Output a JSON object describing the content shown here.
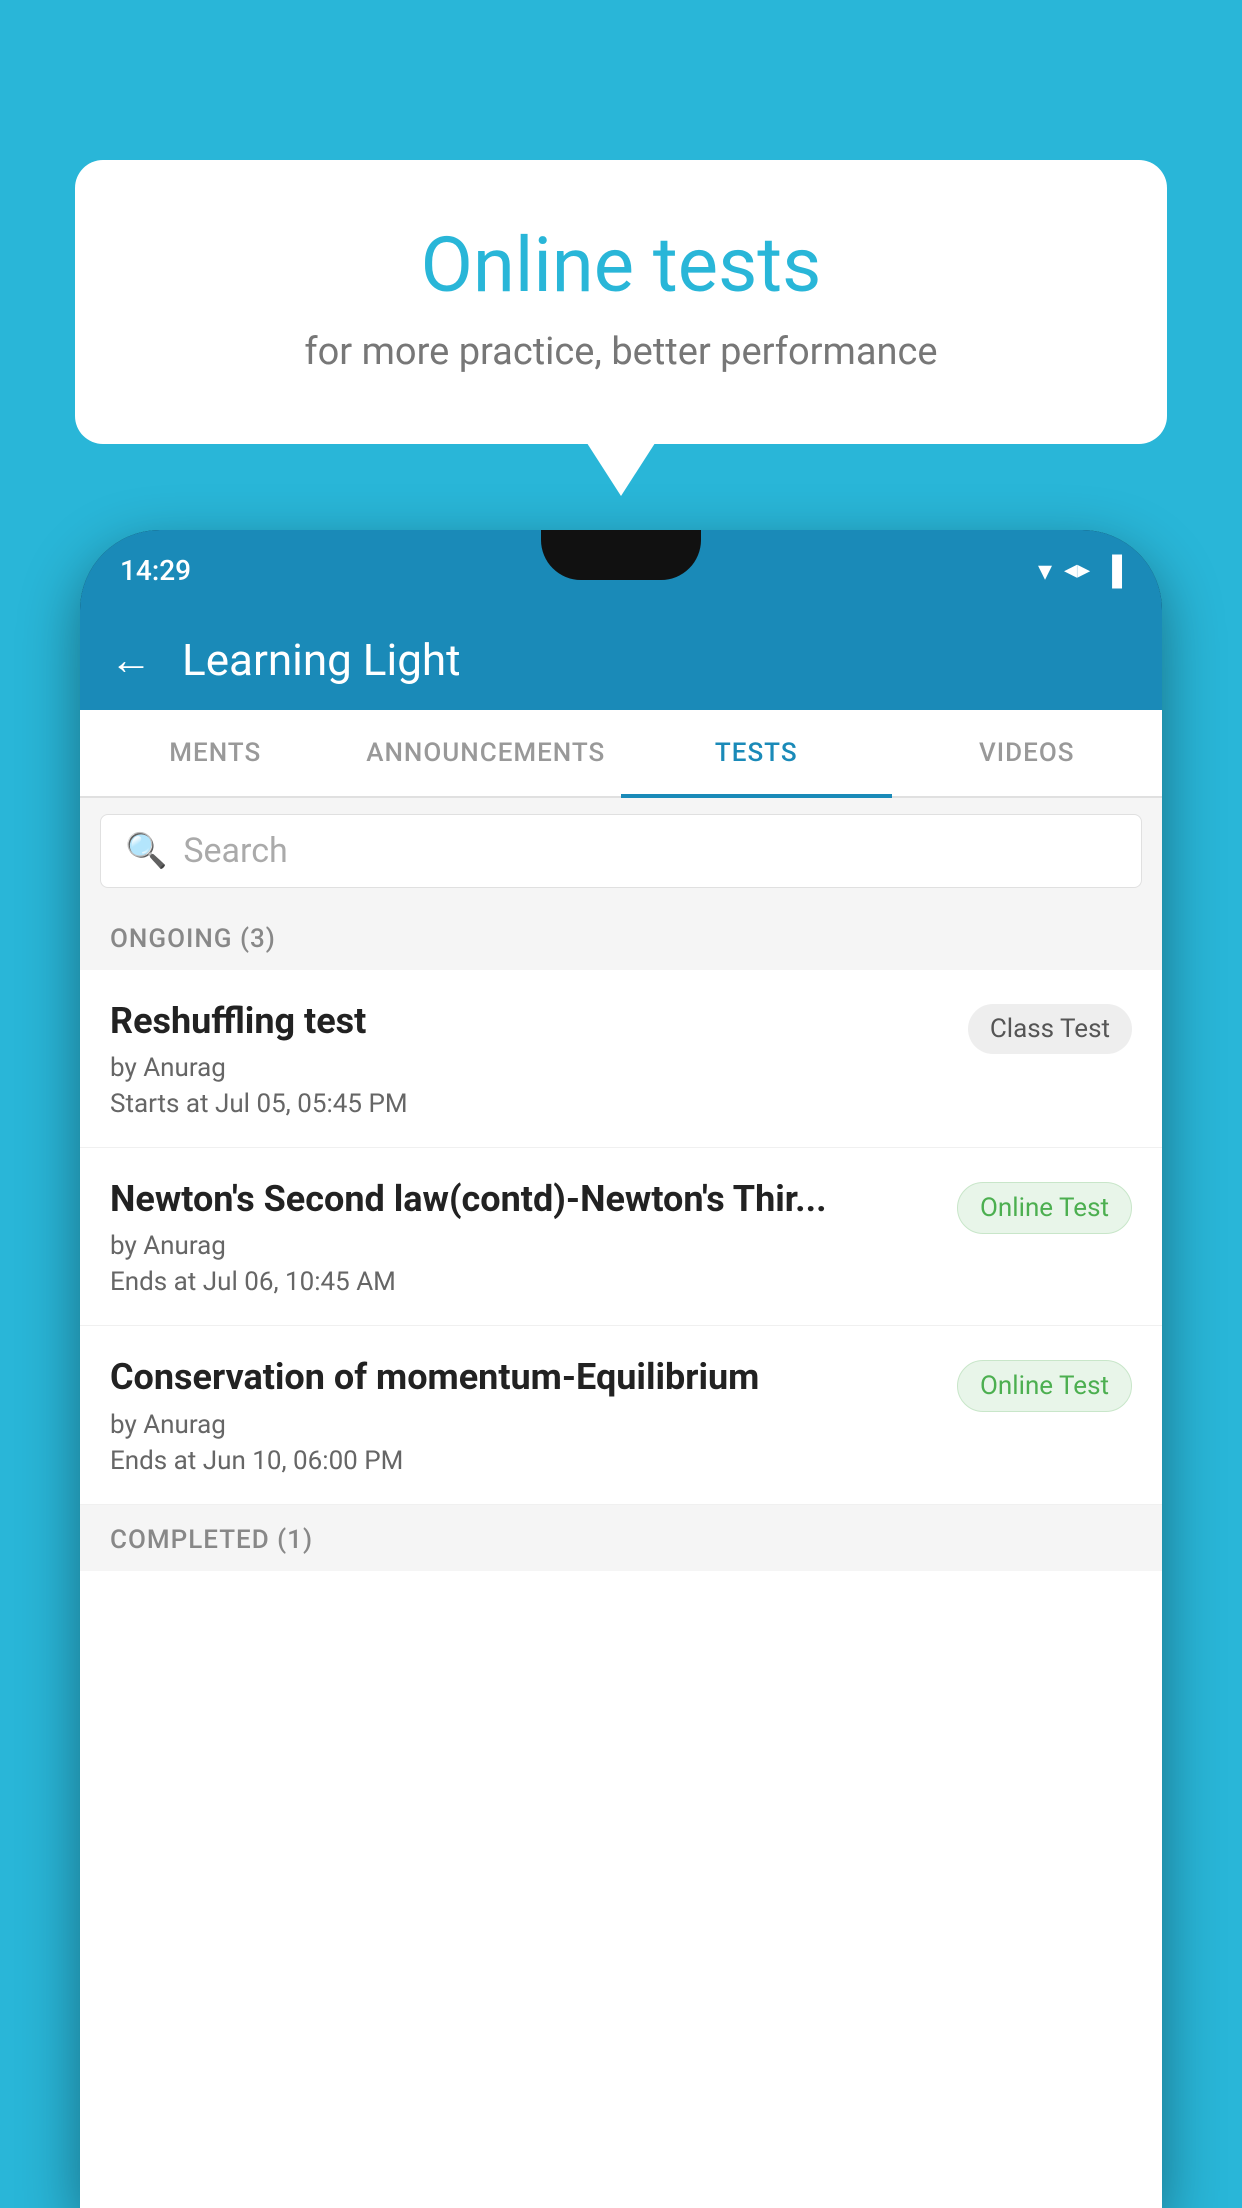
{
  "background": {
    "color": "#29b6d8"
  },
  "speech_bubble": {
    "title": "Online tests",
    "subtitle": "for more practice, better performance"
  },
  "phone": {
    "status_bar": {
      "time": "14:29",
      "wifi_icon": "▼",
      "signal_icon": "▲",
      "battery_icon": "▐"
    },
    "header": {
      "back_label": "←",
      "title": "Learning Light"
    },
    "tabs": [
      {
        "label": "MENTS",
        "active": false
      },
      {
        "label": "ANNOUNCEMENTS",
        "active": false
      },
      {
        "label": "TESTS",
        "active": true
      },
      {
        "label": "VIDEOS",
        "active": false
      }
    ],
    "search": {
      "placeholder": "Search"
    },
    "ongoing_section": {
      "title": "ONGOING (3)"
    },
    "tests": [
      {
        "name": "Reshuffling test",
        "author": "by Anurag",
        "date": "Starts at  Jul 05, 05:45 PM",
        "badge": "Class Test",
        "badge_type": "class"
      },
      {
        "name": "Newton's Second law(contd)-Newton's Thir...",
        "author": "by Anurag",
        "date": "Ends at  Jul 06, 10:45 AM",
        "badge": "Online Test",
        "badge_type": "online"
      },
      {
        "name": "Conservation of momentum-Equilibrium",
        "author": "by Anurag",
        "date": "Ends at  Jun 10, 06:00 PM",
        "badge": "Online Test",
        "badge_type": "online"
      }
    ],
    "completed_section": {
      "title": "COMPLETED (1)"
    }
  }
}
